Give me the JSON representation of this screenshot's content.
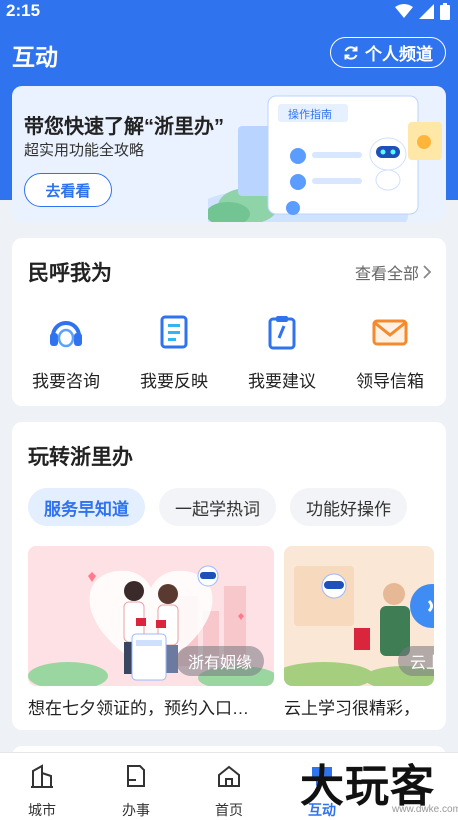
{
  "status_bar": {
    "time": "2:15"
  },
  "header": {
    "title": "互动",
    "channel_button": "个人频道"
  },
  "banner": {
    "title": "带您快速了解“浙里办”",
    "subtitle": "超实用功能全攻略",
    "button": "去看看",
    "art_label": "操作指南"
  },
  "section1": {
    "title": "民呼我为",
    "view_all": "查看全部",
    "services": [
      {
        "label": "我要咨询",
        "icon": "headset-icon"
      },
      {
        "label": "我要反映",
        "icon": "document-icon"
      },
      {
        "label": "我要建议",
        "icon": "clipboard-pen-icon"
      },
      {
        "label": "领导信箱",
        "icon": "mail-icon"
      }
    ]
  },
  "section2": {
    "title": "玩转浙里办",
    "chips": [
      "服务早知道",
      "一起学热词",
      "功能好操作"
    ],
    "cards": [
      {
        "tag": "浙有姻缘",
        "caption": "想在七夕领证的，预约入口…"
      },
      {
        "tag": "云上",
        "caption": "云上学习很精彩，"
      }
    ]
  },
  "tabbar": {
    "items": [
      {
        "label": "城市",
        "icon": "city-icon"
      },
      {
        "label": "办事",
        "icon": "document-icon"
      },
      {
        "label": "首页",
        "icon": "home-icon"
      },
      {
        "label": "互动",
        "icon": "chat-icon"
      }
    ]
  },
  "watermark": {
    "text": "大玩客",
    "url": "www.dwke.com"
  },
  "colors": {
    "primary": "#2f73ee",
    "background": "#eef1f6"
  }
}
